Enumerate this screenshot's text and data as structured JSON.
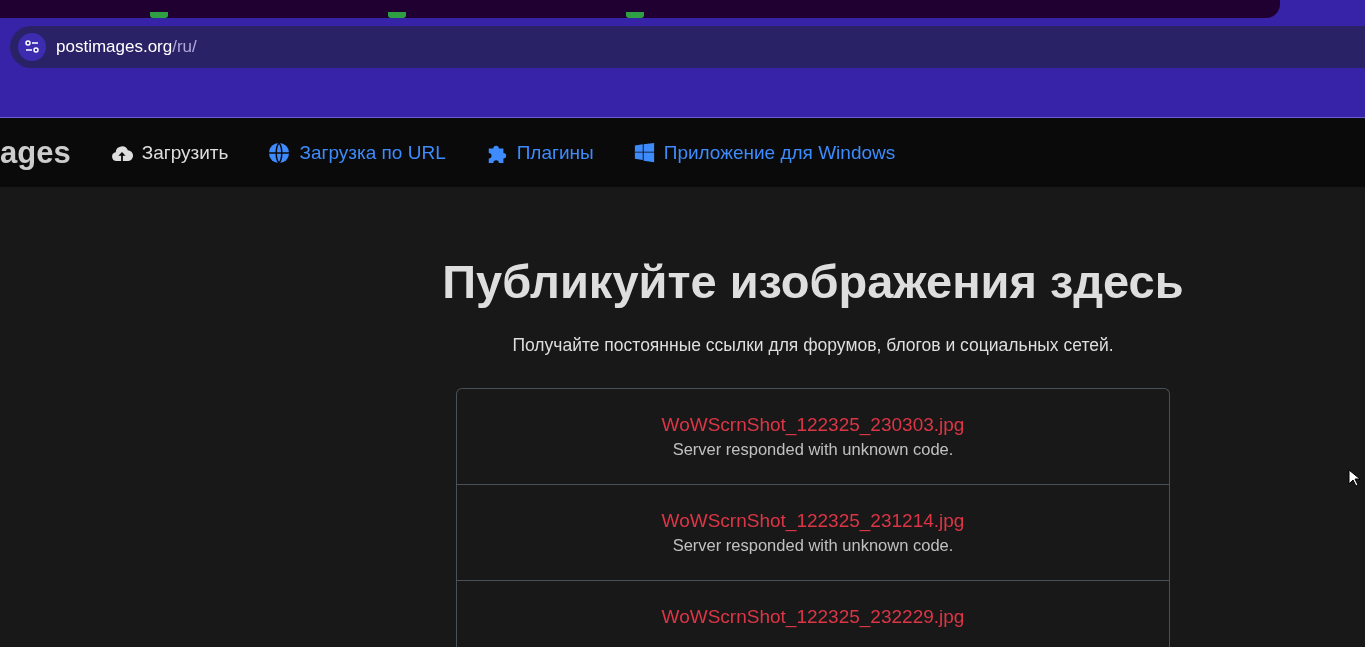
{
  "browser": {
    "url_host": "postimages.org",
    "url_path": "/ru/"
  },
  "navbar": {
    "logo": "ages",
    "items": [
      {
        "label": "Загрузить",
        "kind": "upload"
      },
      {
        "label": "Загрузка по URL",
        "kind": "url"
      },
      {
        "label": "Плагины",
        "kind": "plugins"
      },
      {
        "label": "Приложение для Windows",
        "kind": "windows"
      }
    ]
  },
  "hero": {
    "title": "Публикуйте изображения здесь",
    "subtitle": "Получайте постоянные ссылки для форумов, блогов и социальных сетей."
  },
  "uploads": [
    {
      "filename": "WoWScrnShot_122325_230303.jpg",
      "error": "Server responded with unknown code."
    },
    {
      "filename": "WoWScrnShot_122325_231214.jpg",
      "error": "Server responded with unknown code."
    },
    {
      "filename": "WoWScrnShot_122325_232229.jpg"
    }
  ]
}
